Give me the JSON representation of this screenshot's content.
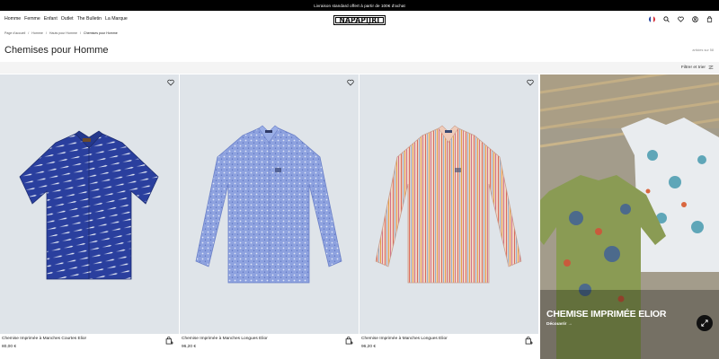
{
  "announcement": "Livraison standard offert à partir de 100€ d'achat",
  "nav": {
    "items": [
      "Homme",
      "Femme",
      "Enfant",
      "Outlet",
      "The Bulletin",
      "La Marque"
    ]
  },
  "logo": "NAPAPIJRI",
  "header_icons": [
    "flag-fr-icon",
    "search-icon",
    "heart-icon",
    "account-icon",
    "bag-icon"
  ],
  "breadcrumb": {
    "items": [
      "Page d'accueil",
      "Homme",
      "Hauts pour Homme",
      "Chemises pour Homme"
    ],
    "separator": "/"
  },
  "page_title": "Chemises pour Homme",
  "result_count": "articles sur 58",
  "filter": {
    "label": "Filtrer et trier"
  },
  "products": [
    {
      "name": "Chemise Imprimée à Manches Courtes Elior",
      "price": "80,00 €"
    },
    {
      "name": "Chemise Imprimée à Manches Longues Elior",
      "price": "96,20 €"
    },
    {
      "name": "Chemise Imprimée à Manches Longues Elior",
      "price": "96,20 €"
    }
  ],
  "promo": {
    "title": "CHEMISE IMPRIMÉE ELIOR",
    "link": "Découvrir",
    "arrow": "→"
  },
  "colors": {
    "announcement_bg": "#000000",
    "product_bg": "#dfe4e9",
    "shirt1": "#2a3f9e",
    "shirt2": "#7f95d8",
    "shirt3": "#e9c8b8"
  }
}
